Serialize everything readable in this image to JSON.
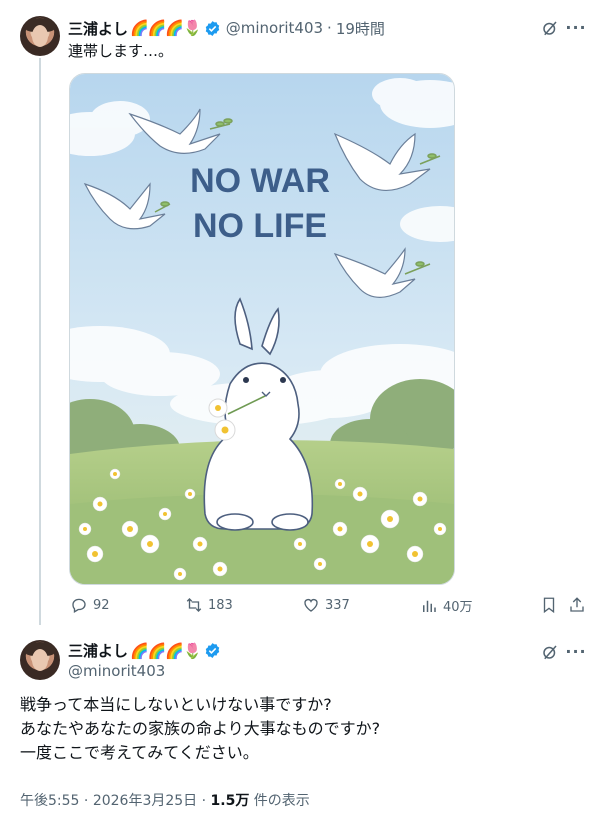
{
  "post": {
    "author_name": "三浦よし",
    "name_emojis": "🌈🌈🌈🌷",
    "handle": "@minorit403",
    "separator": "·",
    "time_ago": "19時間",
    "text": "連帯します…。",
    "image_text_line1": "NO WAR",
    "image_text_line2": "NO LIFE",
    "actions": {
      "replies": "92",
      "reposts": "183",
      "likes": "337",
      "views": "40万"
    }
  },
  "reply": {
    "author_name": "三浦よし",
    "name_emojis": "🌈🌈🌈🌷",
    "handle": "@minorit403",
    "lines": [
      "戦争って本当にしないといけない事ですか?",
      "あなたやあなたの家族の命より大事なものですか?",
      "一度ここで考えてみてください。"
    ],
    "time": "午後5:55",
    "dot": "·",
    "date": "2026年3月25日",
    "views_count": "1.5万",
    "views_label": "件の表示"
  },
  "colors": {
    "accent": "#1d9bf0",
    "text_secondary": "#536471",
    "text_primary": "#0f1419",
    "image_headline": "#3d5e8a"
  },
  "icons": [
    "verified-badge-icon",
    "grok-icon",
    "more-icon",
    "reply-icon",
    "repost-icon",
    "like-icon",
    "views-icon",
    "bookmark-icon",
    "share-icon"
  ]
}
